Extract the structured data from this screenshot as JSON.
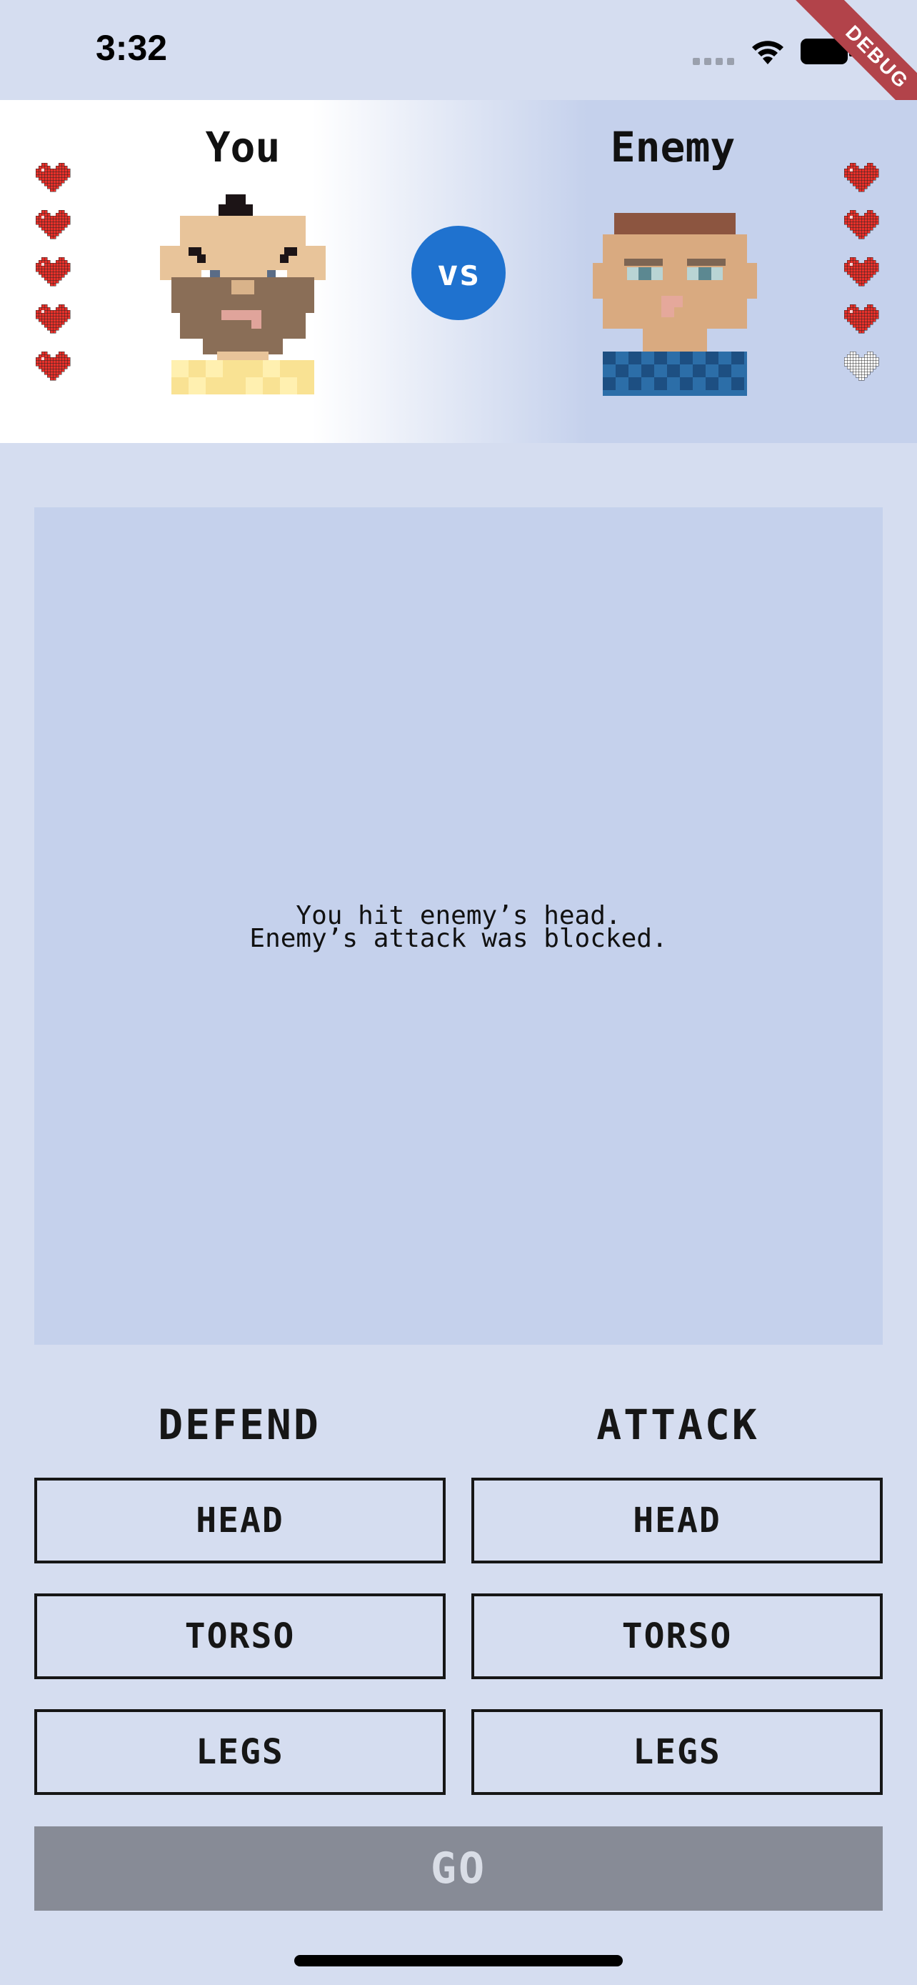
{
  "status_bar": {
    "time": "3:32",
    "icons": [
      "signal-dots-icon",
      "wifi-icon",
      "battery-icon"
    ]
  },
  "debug_ribbon": {
    "label": "DEBUG",
    "color": "#b2434a"
  },
  "fighters": {
    "you": {
      "name": "You",
      "lives_total": 5,
      "lives_remaining": 5
    },
    "enemy": {
      "name": "Enemy",
      "lives_total": 5,
      "lives_remaining": 4
    },
    "vs_label": "vs",
    "vs_color": "#1f72cf"
  },
  "battle_log": {
    "text": "You hit enemy’s head.\nEnemy’s attack was blocked."
  },
  "controls": {
    "defend": {
      "title": "DEFEND",
      "options": [
        "HEAD",
        "TORSO",
        "LEGS"
      ]
    },
    "attack": {
      "title": "ATTACK",
      "options": [
        "HEAD",
        "TORSO",
        "LEGS"
      ]
    },
    "go_label": "GO",
    "go_enabled": false
  },
  "colors": {
    "background": "#d5ddf0",
    "panel": "#c5d1ec",
    "heart_full": "#e8302a",
    "heart_empty": "#ffffff",
    "go_disabled": "#878b96"
  }
}
